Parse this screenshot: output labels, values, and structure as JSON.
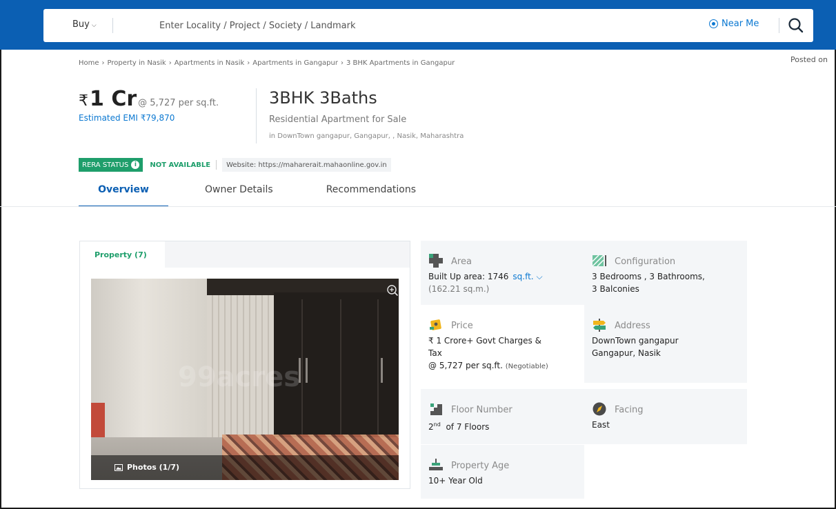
{
  "header": {
    "buy_label": "Buy",
    "search_placeholder": "Enter Locality / Project / Society / Landmark",
    "near_me_label": "Near Me"
  },
  "breadcrumb": [
    "Home",
    "Property in Nasik",
    "Apartments in Nasik",
    "Apartments in Gangapur",
    "3 BHK Apartments in Gangapur"
  ],
  "posted_on_label": "Posted on",
  "listing": {
    "price_symbol": "₹",
    "price_value": "1 Cr",
    "price_per_sqft": "@ 5,727 per sq.ft.",
    "emi": "Estimated EMI ₹79,870",
    "title": "3BHK 3Baths",
    "subtitle": "Residential Apartment for Sale",
    "location": "in DownTown gangapur, Gangapur, , Nasik, Maharashtra"
  },
  "rera": {
    "status_label": "RERA STATUS",
    "status_value": "NOT AVAILABLE",
    "website": "Website: https://maharerait.mahaonline.gov.in"
  },
  "tabs": [
    "Overview",
    "Owner Details",
    "Recommendations"
  ],
  "gallery": {
    "tab_label": "Property (7)",
    "watermark": "99acres",
    "photos_label": "Photos (1/7)"
  },
  "details": {
    "area": {
      "label": "Area",
      "value": "Built Up area: 1746",
      "unit": "sq.ft.",
      "secondary": "(162.21 sq.m.)"
    },
    "configuration": {
      "label": "Configuration",
      "line1": "3 Bedrooms , 3 Bathrooms,",
      "line2": "3 Balconies"
    },
    "price": {
      "label": "Price",
      "line1": "₹ 1 Crore+ Govt Charges &",
      "line2": "Tax",
      "line3": "@ 5,727 per sq.ft.",
      "note": "(Negotiable)"
    },
    "address": {
      "label": "Address",
      "line1": "DownTown gangapur",
      "line2": "Gangapur, Nasik"
    },
    "floor": {
      "label": "Floor Number",
      "number": "2",
      "suffix": "nd",
      "rest": "of 7 Floors"
    },
    "facing": {
      "label": "Facing",
      "value": "East"
    },
    "age": {
      "label": "Property Age",
      "value": "10+ Year Old"
    }
  },
  "colors": {
    "brand_blue": "#0b5fb3",
    "link_blue": "#0b78d1",
    "rera_green": "#1e9e6b"
  }
}
